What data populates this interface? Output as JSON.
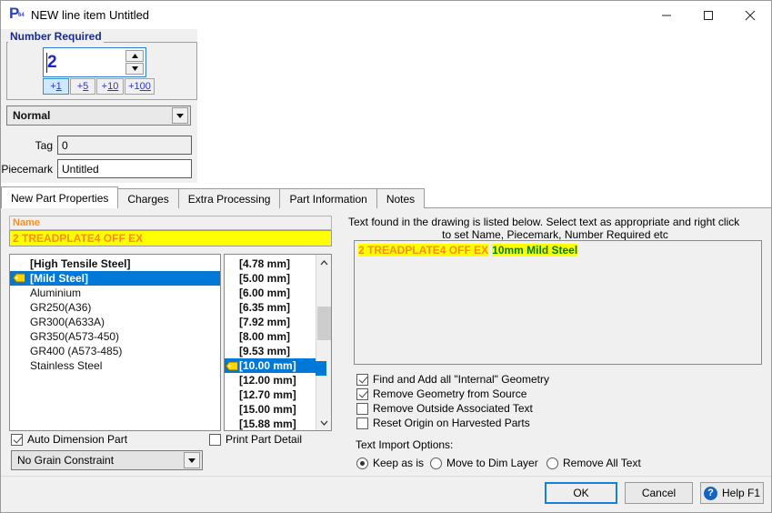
{
  "window": {
    "title": "NEW line item Untitled",
    "icon": "app-p-icon",
    "minimize_label": "—",
    "maximize_label": "□",
    "close_label": "✕"
  },
  "number_required": {
    "group_label": "Number Required",
    "value": "2",
    "steps": [
      {
        "label": "+1",
        "underline": "1",
        "selected": true
      },
      {
        "label": "+5",
        "underline": "5",
        "selected": false
      },
      {
        "label": "+10",
        "underline": "10",
        "selected": false
      },
      {
        "label": "+100",
        "underline": "00",
        "selected": false
      }
    ],
    "mode_combo": {
      "value": "Normal"
    }
  },
  "fields": {
    "tag_label": "Tag",
    "tag_value": "0",
    "piecemark_label": "Piecemark",
    "piecemark_value": "Untitled"
  },
  "tabs": [
    {
      "label": "New Part Properties",
      "active": true
    },
    {
      "label": "Charges",
      "active": false
    },
    {
      "label": "Extra Processing",
      "active": false
    },
    {
      "label": "Part Information",
      "active": false
    },
    {
      "label": "Notes",
      "active": false
    }
  ],
  "name_section": {
    "header": "Name",
    "value": "2 TREADPLATE4 OFF EX"
  },
  "material_list": [
    {
      "label": "[High Tensile Steel]",
      "style": "bracket",
      "selected": false,
      "tagged": false
    },
    {
      "label": "[Mild Steel]",
      "style": "bracket",
      "selected": true,
      "tagged": true
    },
    {
      "label": "Aluminium",
      "style": "plain",
      "selected": false,
      "tagged": false
    },
    {
      "label": "GR250(A36)",
      "style": "plain",
      "selected": false,
      "tagged": false
    },
    {
      "label": "GR300(A633A)",
      "style": "plain",
      "selected": false,
      "tagged": false
    },
    {
      "label": "GR350(A573-450)",
      "style": "plain",
      "selected": false,
      "tagged": false
    },
    {
      "label": "GR400 (A573-485)",
      "style": "plain",
      "selected": false,
      "tagged": false
    },
    {
      "label": "Stainless Steel",
      "style": "plain",
      "selected": false,
      "tagged": false
    }
  ],
  "thickness_list": [
    {
      "label": "[4.78 mm]",
      "selected": false
    },
    {
      "label": "[5.00 mm]",
      "selected": false
    },
    {
      "label": "[6.00 mm]",
      "selected": false
    },
    {
      "label": "[6.35 mm]",
      "selected": false
    },
    {
      "label": "[7.92 mm]",
      "selected": false
    },
    {
      "label": "[8.00 mm]",
      "selected": false
    },
    {
      "label": "[9.53 mm]",
      "selected": false
    },
    {
      "label": "[10.00 mm]",
      "selected": true
    },
    {
      "label": "[12.00 mm]",
      "selected": false
    },
    {
      "label": "[12.70 mm]",
      "selected": false
    },
    {
      "label": "[15.00 mm]",
      "selected": false
    },
    {
      "label": "[15.88 mm]",
      "selected": false
    }
  ],
  "left_options": {
    "auto_dimension": {
      "label": "Auto Dimension Part",
      "checked": true
    },
    "print_part_detail": {
      "label": "Print Part Detail",
      "checked": false
    },
    "grain_combo": {
      "value": "No Grain Constraint"
    }
  },
  "right_panel": {
    "hint_line1": "Text found in the drawing is listed below.  Select text as appropriate and right click",
    "hint_line2": "to set Name, Piecemark, Number Required etc",
    "found_text_segments": [
      {
        "text": "2 TREADPLATE4 OFF EX",
        "color": "#ff8c1a",
        "background": "#ffff00"
      },
      {
        "text": "10mm Mild Steel",
        "color": "#008000",
        "background": "#ffff00"
      }
    ],
    "checkboxes": [
      {
        "label": "Find and Add all \"Internal\" Geometry",
        "checked": true
      },
      {
        "label": "Remove Geometry from Source",
        "checked": true
      },
      {
        "label": "Remove Outside Associated Text",
        "checked": false
      },
      {
        "label": "Reset Origin on Harvested Parts",
        "checked": false
      }
    ],
    "text_import_label": "Text Import Options:",
    "radios": [
      {
        "label": "Keep as is",
        "checked": true
      },
      {
        "label": "Move to Dim Layer",
        "checked": false
      },
      {
        "label": "Remove All Text",
        "checked": false
      }
    ]
  },
  "footer": {
    "ok": "OK",
    "cancel": "Cancel",
    "help": "Help F1",
    "help_icon_glyph": "?"
  },
  "colors": {
    "accent_blue": "#0078d7",
    "highlight_yellow": "#ffff00",
    "name_orange": "#ff8c1a",
    "found_green": "#008000",
    "group_label_blue": "#1b2a8f",
    "spin_value_blue": "#1a25cf"
  }
}
